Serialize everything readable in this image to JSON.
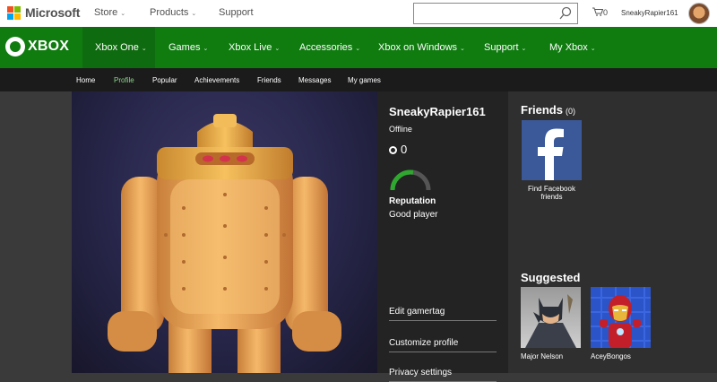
{
  "ms_header": {
    "brand": "Microsoft",
    "nav": [
      {
        "label": "Store",
        "has_chevron": true
      },
      {
        "label": "Products",
        "has_chevron": true
      },
      {
        "label": "Support",
        "has_chevron": false
      }
    ],
    "search_placeholder": "",
    "cart_count": "0",
    "username": "SneakyRapier161",
    "logo_colors": [
      "#f25022",
      "#7fba00",
      "#00a4ef",
      "#ffb900"
    ]
  },
  "xbox_header": {
    "brand": "XBOX",
    "tabs": [
      "Xbox One",
      "Games",
      "Xbox Live",
      "Accessories",
      "Xbox on Windows",
      "Support",
      "My Xbox"
    ],
    "active_tab": "Xbox One",
    "accent": "#107c10"
  },
  "subnav": {
    "items": [
      "Home",
      "Profile",
      "Popular",
      "Achievements",
      "Friends",
      "Messages",
      "My games"
    ],
    "active": "Profile"
  },
  "profile": {
    "gamertag": "SneakyRapier161",
    "status": "Offline",
    "gamerscore": "0",
    "reputation_label": "Reputation",
    "reputation_value": "Good player",
    "reputation_fraction": 0.55,
    "links": [
      "Edit gamertag",
      "Customize profile",
      "Privacy settings"
    ]
  },
  "friends": {
    "title": "Friends",
    "count": "(0)",
    "facebook_caption": "Find Facebook friends"
  },
  "suggested": {
    "title": "Suggested",
    "people": [
      {
        "name": "Major Nelson",
        "icon": "batman-avatar-icon"
      },
      {
        "name": "AceyBongos",
        "icon": "ironman-avatar-icon"
      }
    ]
  }
}
